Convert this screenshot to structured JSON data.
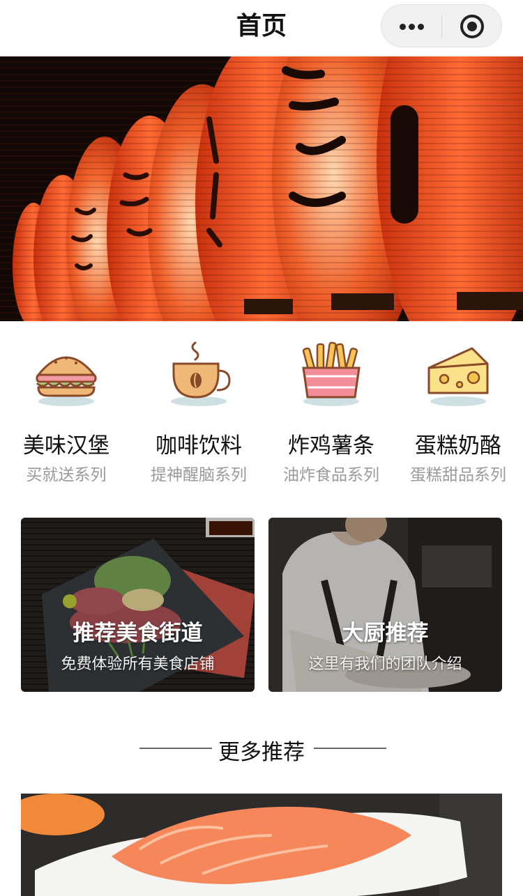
{
  "nav": {
    "title": "首页",
    "menu_icon": "more-dots-icon",
    "close_icon": "target-circle-icon"
  },
  "hero": {
    "image": "red-paper-lanterns-photo"
  },
  "categories": [
    {
      "label": "美味汉堡",
      "sub": "买就送系列",
      "icon": "burger-icon"
    },
    {
      "label": "咖啡饮料",
      "sub": "提神醒脑系列",
      "icon": "coffee-cup-icon"
    },
    {
      "label": "炸鸡薯条",
      "sub": "油炸食品系列",
      "icon": "fries-icon"
    },
    {
      "label": "蛋糕奶酪",
      "sub": "蛋糕甜品系列",
      "icon": "cheese-icon"
    }
  ],
  "cards": [
    {
      "title": "推荐美食街道",
      "subtitle": "免费体验所有美食店铺",
      "image": "seared-tuna-plate-photo"
    },
    {
      "title": "大厨推荐",
      "subtitle": "这里有我们的团队介绍",
      "image": "chef-cooking-photo"
    }
  ],
  "more": {
    "title": "更多推荐"
  },
  "bottom": {
    "image": "salmon-fillet-photo"
  },
  "colors": {
    "lantern_red": "#e8461e",
    "icon_outline": "#8a4a2a",
    "sub_text": "#9a9a9a"
  }
}
